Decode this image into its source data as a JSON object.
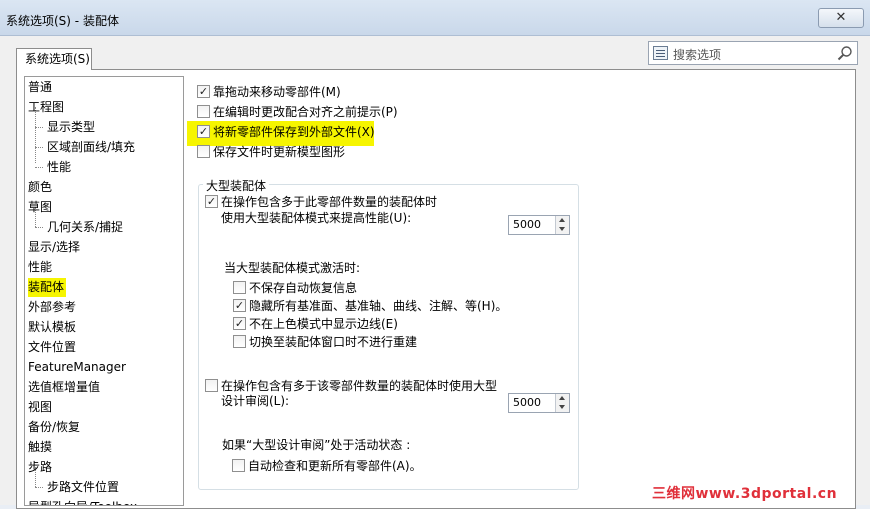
{
  "window": {
    "title": "系统选项(S) - 装配体",
    "close_glyph": "✕"
  },
  "tab": {
    "label": "系统选项(S)"
  },
  "search": {
    "placeholder": "搜索选项"
  },
  "sidebar": {
    "items": [
      {
        "label": "普通"
      },
      {
        "label": "工程图"
      },
      {
        "label": "显示类型"
      },
      {
        "label": "区域剖面线/填充"
      },
      {
        "label": "性能"
      },
      {
        "label": "颜色"
      },
      {
        "label": "草图"
      },
      {
        "label": "几何关系/捕捉"
      },
      {
        "label": "显示/选择"
      },
      {
        "label": "性能"
      },
      {
        "label": "装配体",
        "selected": true
      },
      {
        "label": "外部参考"
      },
      {
        "label": "默认模板"
      },
      {
        "label": "文件位置"
      },
      {
        "label": "FeatureManager"
      },
      {
        "label": "选值框增量值"
      },
      {
        "label": "视图"
      },
      {
        "label": "备份/恢复"
      },
      {
        "label": "触摸"
      },
      {
        "label": "步路"
      },
      {
        "label": "步路文件位置"
      },
      {
        "label": "异型孔向导/Toolbox"
      }
    ]
  },
  "options": {
    "drag_move": {
      "label": "靠拖动来移动零部件(M)",
      "checked": true
    },
    "prompt_edit": {
      "label": "在编辑时更改配合对齐之前提示(P)",
      "checked": false
    },
    "save_external": {
      "label": "将新零部件保存到外部文件(X)",
      "checked": true
    },
    "update_graphics": {
      "label": "保存文件时更新模型图形",
      "checked": false
    }
  },
  "large_assembly": {
    "group_title": "大型装配体",
    "use_mode": {
      "label_line1": "在操作包含多于此零部件数量的装配体时",
      "label_line2": "使用大型装配体模式来提高性能(U):",
      "checked": true,
      "value": "5000"
    },
    "when_active_label": "当大型装配体模式激活时:",
    "sub_options": {
      "no_autorecover": {
        "label": "不保存自动恢复信息",
        "checked": false
      },
      "hide_planes": {
        "label": "隐藏所有基准面、基准轴、曲线、注解、等(H)。",
        "checked": true
      },
      "no_edges": {
        "label": "不在上色模式中显示边线(E)",
        "checked": true
      },
      "no_rebuild": {
        "label": "切换至装配体窗口时不进行重建",
        "checked": false
      }
    },
    "design_review": {
      "label_line1": "在操作包含有多于该零部件数量的装配体时使用大型",
      "label_line2": "设计审阅(L):",
      "checked": false,
      "value": "5000"
    },
    "when_review_label": "如果“大型设计审阅”处于活动状态 :",
    "auto_check": {
      "label": "自动检查和更新所有零部件(A)。",
      "checked": false
    }
  },
  "watermark": "三维网www.3dportal.cn",
  "colors": {
    "highlight": "#f6f500",
    "watermark": "#e0303a"
  }
}
